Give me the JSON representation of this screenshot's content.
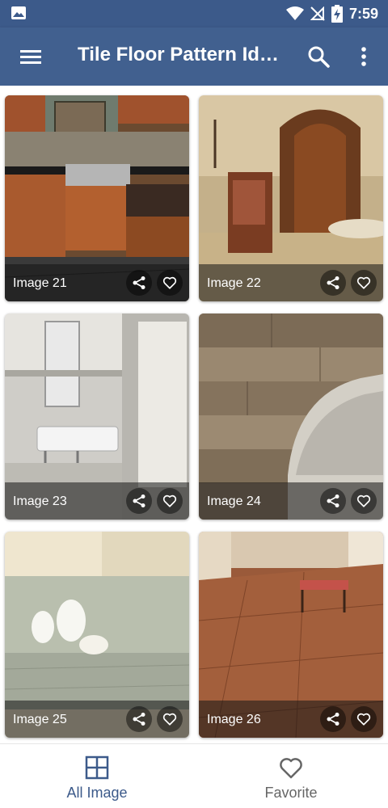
{
  "status_bar": {
    "time": "7:59",
    "icons": [
      "image-icon",
      "wifi-icon",
      "signal-off-icon",
      "battery-charging-icon"
    ]
  },
  "app_bar": {
    "title": "Tile Floor Pattern Id…",
    "icons": [
      "menu-icon",
      "search-icon",
      "more-vert-icon"
    ]
  },
  "gallery": {
    "items": [
      {
        "label": "Image 21"
      },
      {
        "label": "Image 22"
      },
      {
        "label": "Image 23"
      },
      {
        "label": "Image 24"
      },
      {
        "label": "Image 25"
      },
      {
        "label": "Image 26"
      }
    ],
    "item_icons": [
      "share-icon",
      "heart-outline-icon"
    ]
  },
  "bottom_nav": {
    "items": [
      {
        "label": "All Image",
        "icon": "grid-icon",
        "active": true
      },
      {
        "label": "Favorite",
        "icon": "heart-outline-icon",
        "active": false
      }
    ]
  },
  "colors": {
    "primary": "#41608f",
    "status_bar": "#3c5a8a",
    "active_nav": "#3c5a8a",
    "inactive_nav": "#666666"
  }
}
